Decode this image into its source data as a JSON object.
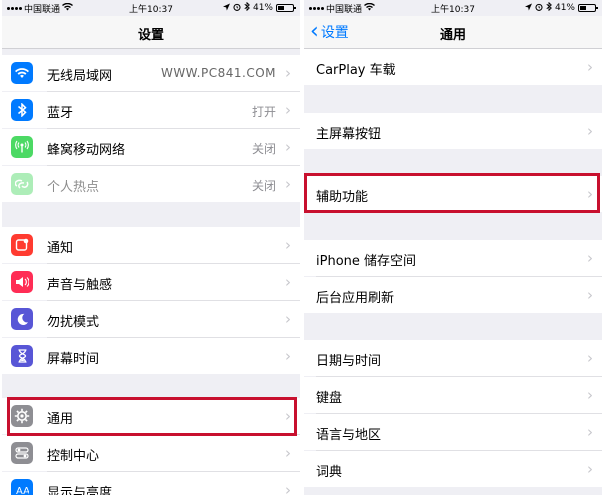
{
  "status_bar": {
    "carrier": "中国联通",
    "time": "上午10:37",
    "battery": "41%"
  },
  "left": {
    "title": "设置",
    "group1": [
      {
        "label": "无线局域网",
        "value": "WWW.PC841.COM",
        "icon": "wifi-icon",
        "color": "#007aff"
      },
      {
        "label": "蓝牙",
        "value": "打开",
        "icon": "bluetooth-icon",
        "color": "#007aff"
      },
      {
        "label": "蜂窝移动网络",
        "value": "关闭",
        "icon": "cellular-icon",
        "color": "#4cd964"
      },
      {
        "label": "个人热点",
        "value": "关闭",
        "icon": "hotspot-icon",
        "color": "#4cd964"
      }
    ],
    "group2": [
      {
        "label": "通知",
        "icon": "notifications-icon",
        "color": "#ff3b30"
      },
      {
        "label": "声音与触感",
        "icon": "sound-icon",
        "color": "#ff2d55"
      },
      {
        "label": "勿扰模式",
        "icon": "moon-icon",
        "color": "#5856d6"
      },
      {
        "label": "屏幕时间",
        "icon": "hourglass-icon",
        "color": "#5856d6"
      }
    ],
    "group3": [
      {
        "label": "通用",
        "icon": "gear-icon",
        "color": "#8e8e93"
      },
      {
        "label": "控制中心",
        "icon": "toggles-icon",
        "color": "#8e8e93"
      },
      {
        "label": "显示与亮度",
        "icon": "display-icon",
        "color": "#007aff"
      }
    ]
  },
  "right": {
    "back_label": "设置",
    "title": "通用",
    "items": {
      "carplay": "CarPlay 车载",
      "home_button": "主屏幕按钮",
      "accessibility": "辅助功能",
      "storage": "iPhone 储存空间",
      "background_refresh": "后台应用刷新",
      "date_time": "日期与时间",
      "keyboard": "键盘",
      "language_region": "语言与地区",
      "dictionary": "词典"
    }
  },
  "colors": {
    "accent": "#007aff",
    "highlight": "#c8102e"
  }
}
